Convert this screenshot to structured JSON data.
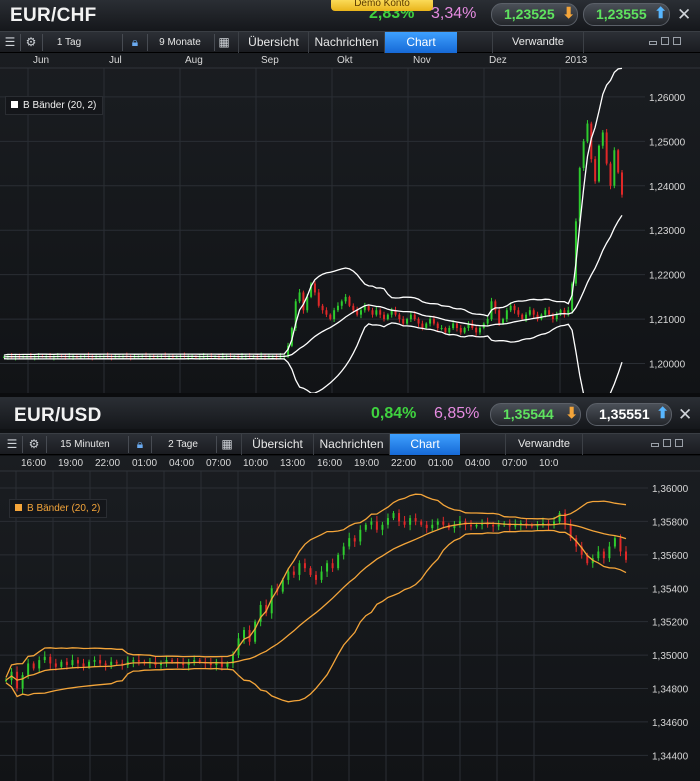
{
  "demo_badge": "Demo Konto",
  "panels": [
    {
      "pair": "EUR/CHF",
      "change_abs": "2,83%",
      "change_pct": "3,34%",
      "sell_price": "1,23525",
      "buy_price": "1,23555",
      "toolbar": {
        "interval": "1 Tag",
        "range": "9 Monate",
        "tabs": [
          "Übersicht",
          "Nachrichten",
          "Chart"
        ],
        "active_tab": "Chart",
        "related": "Verwandte"
      },
      "legend": "B Bänder (20, 2)",
      "band_color": "#ffffff"
    },
    {
      "pair": "EUR/USD",
      "change_abs": "0,84%",
      "change_pct": "6,85%",
      "sell_price": "1,35544",
      "buy_price": "1,35551",
      "toolbar": {
        "interval": "15 Minuten",
        "range": "2 Tage",
        "tabs": [
          "Übersicht",
          "Nachrichten",
          "Chart"
        ],
        "active_tab": "Chart",
        "related": "Verwandte"
      },
      "legend": "B Bänder (20, 2)",
      "band_color": "#f4a53a"
    }
  ],
  "chart_data": [
    {
      "type": "candlestick",
      "title": "EUR/CHF",
      "x_ticks": [
        "Jun",
        "Jul",
        "Aug",
        "Sep",
        "Okt",
        "Nov",
        "Dez",
        "2013"
      ],
      "y_ticks": [
        "1,26000",
        "1,25000",
        "1,24000",
        "1,23000",
        "1,22000",
        "1,21000",
        "1,20000"
      ],
      "ylim": [
        1.199,
        1.262
      ],
      "indicator": "Bollinger Bands (20, 2)",
      "series": [
        {
          "name": "price",
          "values": [
            1.2015,
            1.2016,
            1.2015,
            1.2016,
            1.2015,
            1.2016,
            1.2016,
            1.2015,
            1.2016,
            1.2017,
            1.2016,
            1.2016,
            1.2015,
            1.2016,
            1.2017,
            1.2016,
            1.2015,
            1.2016,
            1.2016,
            1.2015,
            1.2016,
            1.2017,
            1.2016,
            1.2015,
            1.2016,
            1.2016,
            1.2017,
            1.2016,
            1.2015,
            1.2016,
            1.2016,
            1.2017,
            1.2016,
            1.2015,
            1.2016,
            1.2016,
            1.2017,
            1.2016,
            1.2016,
            1.2015,
            1.2016,
            1.2017,
            1.2016,
            1.2016,
            1.2015,
            1.2016,
            1.2017,
            1.2016,
            1.2016,
            1.2016,
            1.2015,
            1.2016,
            1.2016,
            1.2017,
            1.2016,
            1.2016,
            1.2015,
            1.2016,
            1.2017,
            1.2016,
            1.2016,
            1.2015,
            1.2016,
            1.2017,
            1.2016,
            1.2016,
            1.2015,
            1.2017,
            1.2016,
            1.2016,
            1.2016,
            1.2015,
            1.2016,
            1.2018,
            1.204,
            1.208,
            1.214,
            1.216,
            1.212,
            1.215,
            1.218,
            1.216,
            1.213,
            1.212,
            1.211,
            1.21,
            1.212,
            1.213,
            1.214,
            1.215,
            1.213,
            1.212,
            1.211,
            1.212,
            1.213,
            1.212,
            1.211,
            1.212,
            1.211,
            1.21,
            1.211,
            1.212,
            1.211,
            1.21,
            1.209,
            1.21,
            1.211,
            1.21,
            1.209,
            1.208,
            1.209,
            1.21,
            1.209,
            1.208,
            1.208,
            1.207,
            1.208,
            1.209,
            1.208,
            1.207,
            1.208,
            1.209,
            1.208,
            1.207,
            1.208,
            1.209,
            1.21,
            1.214,
            1.212,
            1.209,
            1.21,
            1.212,
            1.213,
            1.212,
            1.211,
            1.21,
            1.211,
            1.212,
            1.211,
            1.21,
            1.211,
            1.212,
            1.211,
            1.21,
            1.211,
            1.212,
            1.211,
            1.212,
            1.218,
            1.232,
            1.244,
            1.25,
            1.254,
            1.246,
            1.241,
            1.249,
            1.252,
            1.245,
            1.24,
            1.248,
            1.243,
            1.238
          ]
        }
      ]
    },
    {
      "type": "candlestick",
      "title": "EUR/USD",
      "x_ticks": [
        "16:00",
        "19:00",
        "22:00",
        "01:00",
        "04:00",
        "07:00",
        "10:00",
        "13:00",
        "16:00",
        "19:00",
        "22:00",
        "01:00",
        "04:00",
        "07:00",
        "10:0"
      ],
      "y_ticks": [
        "1,36000",
        "1,35800",
        "1,35600",
        "1,35400",
        "1,35200",
        "1,35000",
        "1,34800",
        "1,34600",
        "1,34400"
      ],
      "ylim": [
        1.3436,
        1.3606
      ],
      "indicator": "Bollinger Bands (20, 2)",
      "series": [
        {
          "name": "price",
          "values": [
            1.3485,
            1.349,
            1.348,
            1.3488,
            1.3495,
            1.3492,
            1.3497,
            1.3499,
            1.3495,
            1.3493,
            1.3496,
            1.3494,
            1.3497,
            1.3495,
            1.3493,
            1.3496,
            1.3497,
            1.3495,
            1.3494,
            1.3496,
            1.3495,
            1.3494,
            1.3496,
            1.3497,
            1.3496,
            1.3495,
            1.3496,
            1.3494,
            1.3495,
            1.3497,
            1.3496,
            1.3495,
            1.3494,
            1.3496,
            1.3497,
            1.3496,
            1.3495,
            1.3494,
            1.3496,
            1.3493,
            1.3495,
            1.35,
            1.351,
            1.3515,
            1.3508,
            1.352,
            1.353,
            1.3525,
            1.354,
            1.3538,
            1.3545,
            1.355,
            1.3548,
            1.3555,
            1.3552,
            1.3548,
            1.3545,
            1.355,
            1.3555,
            1.3552,
            1.356,
            1.3565,
            1.357,
            1.3568,
            1.3575,
            1.3578,
            1.358,
            1.3575,
            1.3578,
            1.3582,
            1.3585,
            1.358,
            1.3578,
            1.3582,
            1.358,
            1.3578,
            1.3576,
            1.3578,
            1.358,
            1.3578,
            1.3576,
            1.3578,
            1.358,
            1.3578,
            1.3577,
            1.3578,
            1.3579,
            1.3578,
            1.3577,
            1.3578,
            1.3579,
            1.3577,
            1.3578,
            1.3579,
            1.3578,
            1.3577,
            1.3578,
            1.3579,
            1.3578,
            1.358,
            1.3585,
            1.3578,
            1.357,
            1.3565,
            1.356,
            1.3555,
            1.3558,
            1.3562,
            1.3558,
            1.3565,
            1.357,
            1.3562,
            1.3557
          ]
        }
      ]
    }
  ]
}
